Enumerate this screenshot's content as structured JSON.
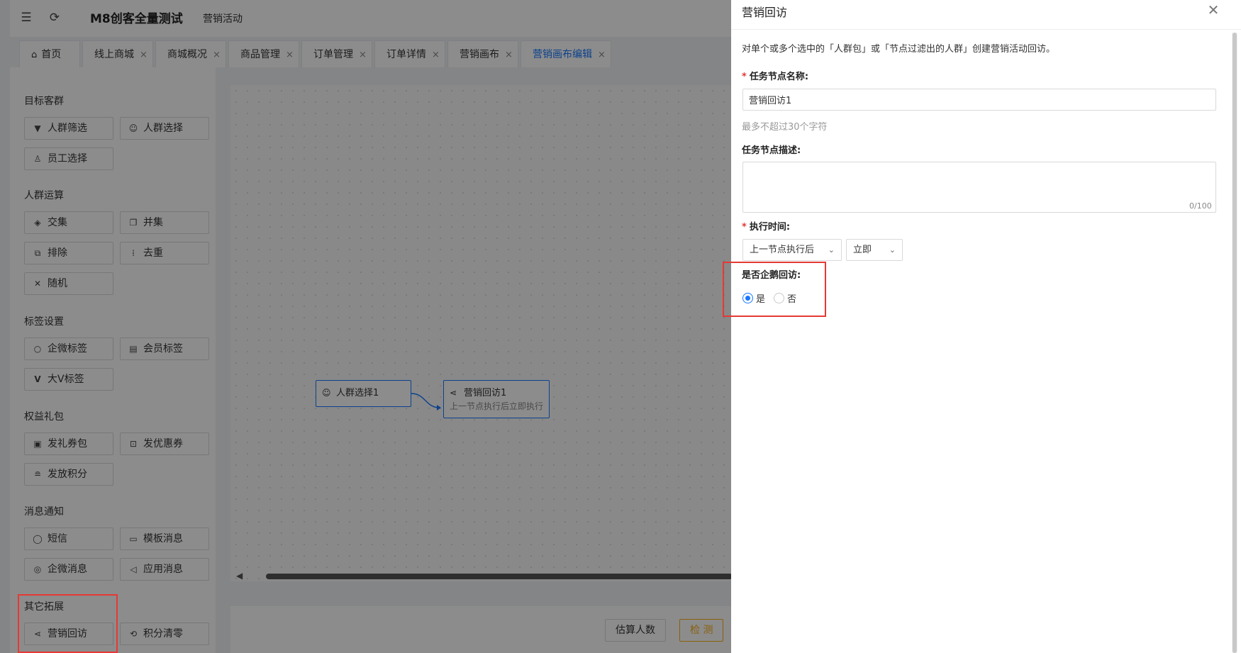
{
  "topbar": {
    "menu_icon": "menu-fold-icon",
    "refresh_icon": "refresh-icon",
    "brand": "M8创客全量测试",
    "subtitle": "营销活动"
  },
  "tabs": [
    {
      "label": "首页",
      "icon": "home-icon",
      "active": false,
      "closable": false
    },
    {
      "label": "线上商城",
      "active": false,
      "closable": true
    },
    {
      "label": "商城概况",
      "active": false,
      "closable": true
    },
    {
      "label": "商品管理",
      "active": false,
      "closable": true
    },
    {
      "label": "订单管理",
      "active": false,
      "closable": true
    },
    {
      "label": "订单详情",
      "active": false,
      "closable": true
    },
    {
      "label": "营销画布",
      "active": false,
      "closable": true
    },
    {
      "label": "营销画布编辑",
      "active": true,
      "closable": true
    }
  ],
  "tab_close_glyph": "×",
  "left_panel": {
    "sections": [
      {
        "title": "目标客群",
        "items": [
          {
            "label": "人群筛选",
            "icon": "filter-icon"
          },
          {
            "label": "人群选择",
            "icon": "user-icon"
          },
          {
            "label": "员工选择",
            "icon": "staff-icon"
          }
        ]
      },
      {
        "title": "人群运算",
        "items": [
          {
            "label": "交集",
            "icon": "intersect-icon"
          },
          {
            "label": "并集",
            "icon": "union-icon"
          },
          {
            "label": "排除",
            "icon": "exclude-icon"
          },
          {
            "label": "去重",
            "icon": "dedupe-icon"
          },
          {
            "label": "随机",
            "icon": "shuffle-icon"
          }
        ]
      },
      {
        "title": "标签设置",
        "items": [
          {
            "label": "企微标签",
            "icon": "wecom-tag-icon"
          },
          {
            "label": "会员标签",
            "icon": "member-tag-icon"
          },
          {
            "label": "大V标签",
            "icon": "v-tag-icon"
          }
        ]
      },
      {
        "title": "权益礼包",
        "items": [
          {
            "label": "发礼券包",
            "icon": "gift-icon"
          },
          {
            "label": "发优惠券",
            "icon": "coupon-icon"
          },
          {
            "label": "发放积分",
            "icon": "points-icon"
          }
        ]
      },
      {
        "title": "消息通知",
        "items": [
          {
            "label": "短信",
            "icon": "sms-icon"
          },
          {
            "label": "模板消息",
            "icon": "template-msg-icon"
          },
          {
            "label": "企微消息",
            "icon": "wecom-msg-icon"
          },
          {
            "label": "应用消息",
            "icon": "app-msg-icon"
          }
        ]
      },
      {
        "title": "其它拓展",
        "items": [
          {
            "label": "营销回访",
            "icon": "share-icon"
          },
          {
            "label": "积分清零",
            "icon": "reset-icon"
          }
        ]
      }
    ]
  },
  "canvas": {
    "nodes": [
      {
        "label": "人群选择1",
        "icon": "user-icon"
      },
      {
        "label": "营销回访1",
        "icon": "share-icon",
        "sub": "上一节点执行后立即执行"
      }
    ]
  },
  "bottom_bar": {
    "estimate_label": "估算人数",
    "check_label": "检 测"
  },
  "drawer": {
    "title": "营销回访",
    "close_icon": "close-icon",
    "description": "对单个或多个选中的「人群包」或「节点过滤出的人群」创建营销活动回访。",
    "required_mark": "*",
    "name_label": "任务节点名称:",
    "name_value": "营销回访1",
    "name_hint": "最多不超过30个字符",
    "desc_label": "任务节点描述:",
    "desc_value": "",
    "desc_counter": "0/100",
    "time_label": "执行时间:",
    "time_select_1": "上一节点执行后",
    "time_select_2": "立即",
    "wecom_label": "是否企鹅回访:",
    "radio_yes": "是",
    "radio_no": "否",
    "selected": "是"
  },
  "colors": {
    "primary": "#1677ff",
    "highlight_border": "#e53935",
    "required": "#e53935",
    "check_button": "#faad14"
  }
}
